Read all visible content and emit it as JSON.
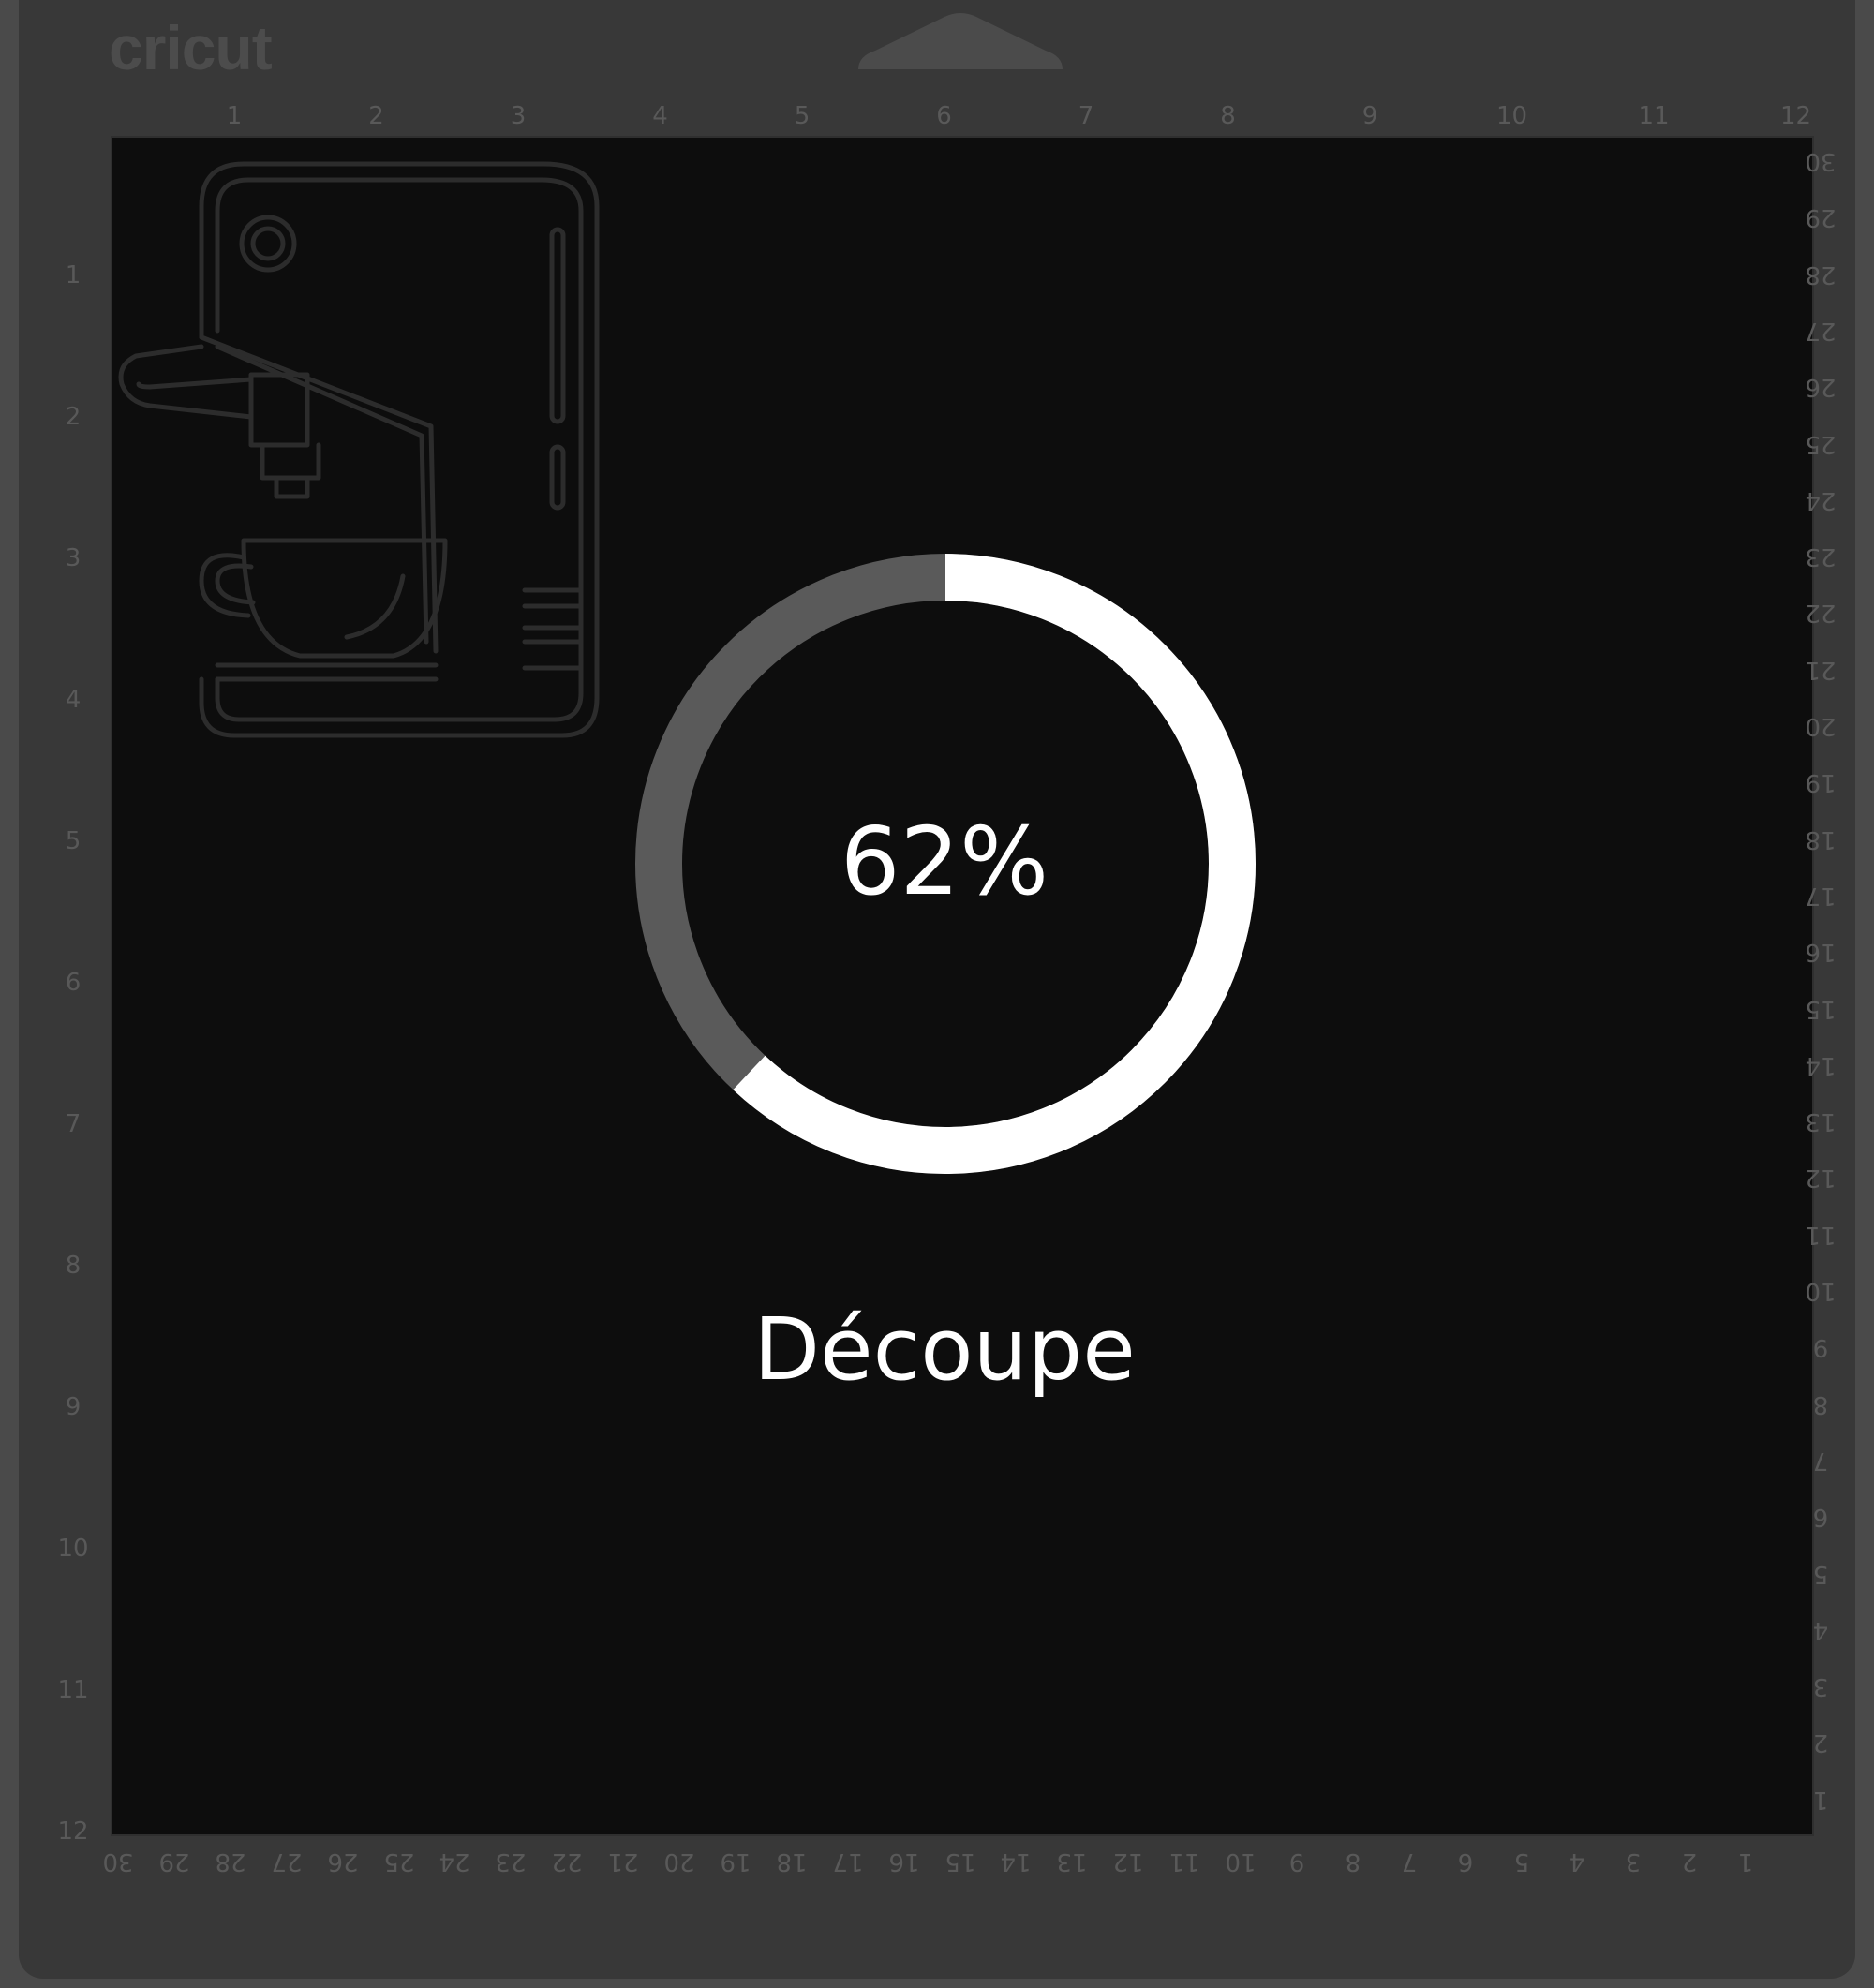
{
  "mat": {
    "brand": "cricut",
    "ruler_top": [
      "1",
      "2",
      "3",
      "4",
      "5",
      "6",
      "7",
      "8",
      "9",
      "10",
      "11",
      "12"
    ],
    "ruler_left": [
      "1",
      "2",
      "3",
      "4",
      "5",
      "6",
      "7",
      "8",
      "9",
      "10",
      "11",
      "12"
    ],
    "ruler_right": [
      "30",
      "29",
      "28",
      "27",
      "26",
      "25",
      "24",
      "23",
      "22",
      "21",
      "20",
      "19",
      "18",
      "17",
      "16",
      "15",
      "14",
      "13",
      "12",
      "11",
      "10",
      "9",
      "8",
      "7",
      "6",
      "5",
      "4",
      "3",
      "2",
      "1"
    ],
    "ruler_bottom": [
      "30",
      "29",
      "28",
      "27",
      "26",
      "25",
      "24",
      "23",
      "22",
      "21",
      "20",
      "19",
      "18",
      "17",
      "16",
      "15",
      "14",
      "13",
      "12",
      "11",
      "10",
      "9",
      "8",
      "7",
      "6",
      "5",
      "4",
      "3",
      "2",
      "1"
    ]
  },
  "design": {
    "icon": "espresso-machine-icon"
  },
  "progress": {
    "value": 0.62,
    "label": "62%",
    "status": "Découpe"
  },
  "colors": {
    "progress_fill": "#ffffff",
    "progress_track": "#5a5a5a",
    "design_stroke": "#2c2c2c"
  }
}
